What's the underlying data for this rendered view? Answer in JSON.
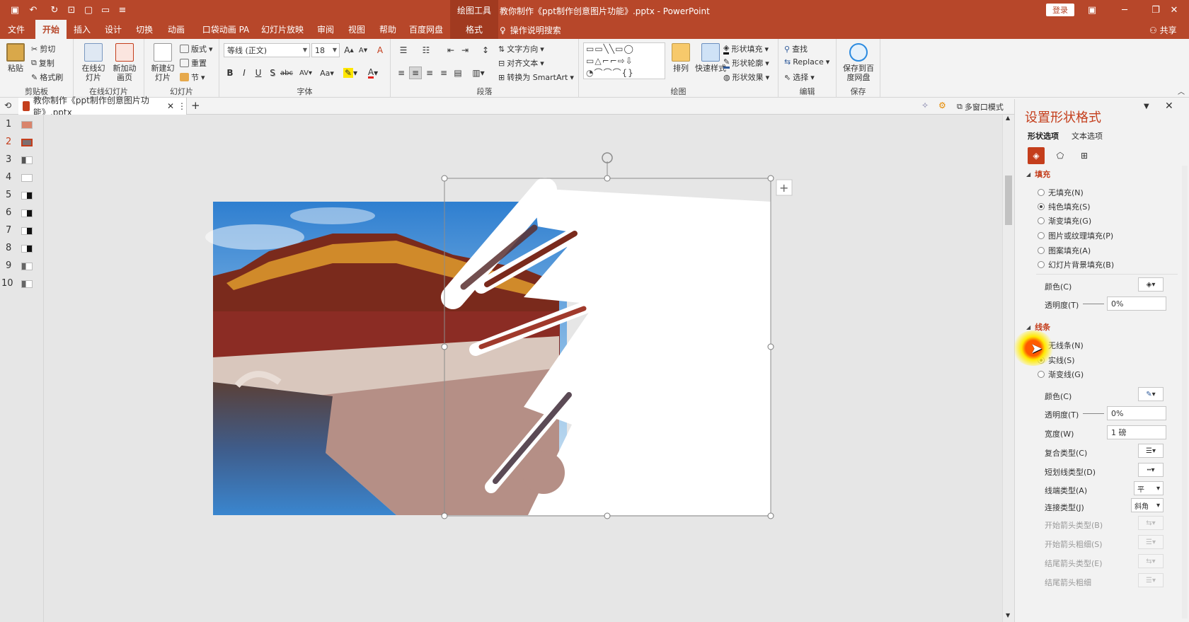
{
  "titlebar": {
    "context_tool": "绘图工具",
    "doc_title": "教你制作《ppt制作创意图片功能》.pptx  -  PowerPoint",
    "login": "登录"
  },
  "menu_tabs": [
    "文件",
    "开始",
    "插入",
    "设计",
    "切换",
    "动画",
    "口袋动画 PA",
    "幻灯片放映",
    "审阅",
    "视图",
    "帮助",
    "百度网盘",
    "格式"
  ],
  "tell_me": "操作说明搜索",
  "share": "共享",
  "ribbon": {
    "clipboard": {
      "label": "剪贴板",
      "paste": "粘贴",
      "cut": "剪切",
      "copy": "复制",
      "format_painter": "格式刷"
    },
    "online": {
      "label": "在线幻灯片",
      "online_slide": "在线幻灯片",
      "new_anim": "新加动画页"
    },
    "slides": {
      "label": "幻灯片",
      "new_slide": "新建幻灯片",
      "layout": "版式",
      "reset": "重置",
      "section": "节"
    },
    "font": {
      "label": "字体",
      "family": "等线 (正文)",
      "size": "18",
      "bold": "B",
      "italic": "I",
      "underline": "U",
      "shadow": "S",
      "strike": "abc",
      "spacing": "AV",
      "case": "Aa",
      "grow": "A",
      "shrink": "A",
      "clear": "A"
    },
    "paragraph": {
      "label": "段落",
      "text_direction": "文字方向",
      "align_text": "对齐文本",
      "smartart": "转换为 SmartArt"
    },
    "drawing": {
      "label": "绘图",
      "arrange": "排列",
      "quick_styles": "快速样式",
      "shape_fill": "形状填充",
      "shape_outline": "形状轮廓",
      "shape_effects": "形状效果"
    },
    "editing": {
      "label": "编辑",
      "find": "查找",
      "replace": "Replace",
      "select": "选择"
    },
    "save": {
      "label": "保存",
      "save_baidu": "保存到百度网盘"
    }
  },
  "doc_tab": "教你制作《ppt制作创意图片功能》.pptx",
  "multi_window": "多窗口模式",
  "slide_numbers": [
    "1",
    "2",
    "3",
    "4",
    "5",
    "6",
    "7",
    "8",
    "9",
    "10"
  ],
  "selected_slide": 2,
  "panel": {
    "title": "设置形状格式",
    "tabs": [
      "形状选项",
      "文本选项"
    ],
    "fill_header": "填充",
    "fill_options": [
      "无填充(N)",
      "纯色填充(S)",
      "渐变填充(G)",
      "图片或纹理填充(P)",
      "图案填充(A)",
      "幻灯片背景填充(B)"
    ],
    "fill_selected": 1,
    "color_label": "颜色(C)",
    "transparency_label": "透明度(T)",
    "transparency_value": "0%",
    "line_header": "线条",
    "line_options": [
      "无线条(N)",
      "实线(S)",
      "渐变线(G)"
    ],
    "line_selected": 1,
    "line_color_label": "颜色(C)",
    "line_transparency_label": "透明度(T)",
    "line_transparency_value": "0%",
    "width_label": "宽度(W)",
    "width_value": "1 磅",
    "compound_label": "复合类型(C)",
    "dash_label": "短划线类型(D)",
    "cap_label": "线端类型(A)",
    "cap_value": "平",
    "join_label": "连接类型(J)",
    "join_value": "斜角",
    "begin_arrow_type": "开始箭头类型(B)",
    "begin_arrow_size": "开始箭头粗细(S)",
    "end_arrow_type": "结尾箭头类型(E)",
    "end_arrow_size": "结尾箭头粗细"
  },
  "colors": {
    "accent": "#b7472a",
    "accent_dark": "#a13a20",
    "panel_title": "#c43e1c"
  }
}
